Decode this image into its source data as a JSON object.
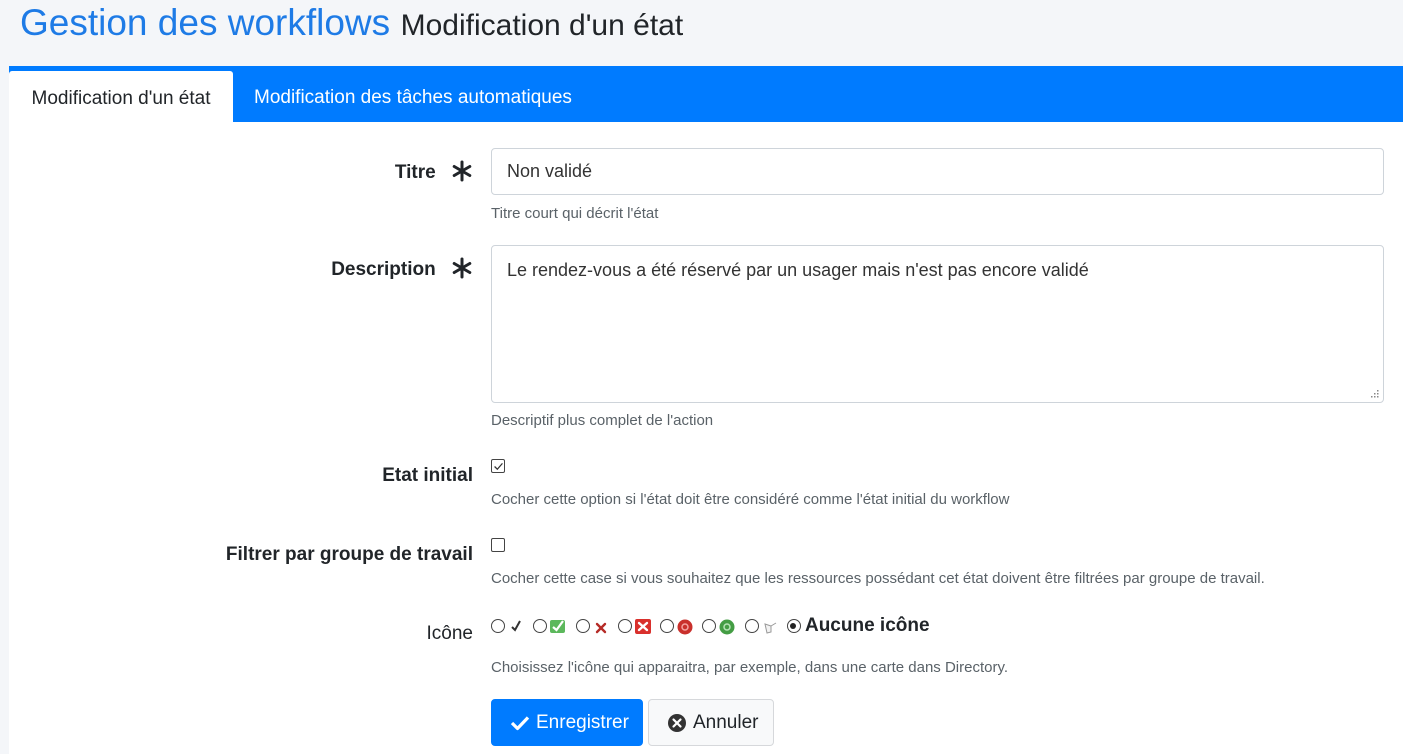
{
  "header": {
    "title": "Gestion des workflows",
    "subtitle": "Modification d'un état"
  },
  "tabs": [
    {
      "label": "Modification d'un état",
      "active": true
    },
    {
      "label": "Modification des tâches automatiques",
      "active": false
    }
  ],
  "form": {
    "title_field": {
      "label": "Titre",
      "value": "Non validé",
      "help": "Titre court qui décrit l'état"
    },
    "description_field": {
      "label": "Description",
      "value": "Le rendez-vous a été réservé par un usager mais n'est pas encore validé",
      "help": "Descriptif plus complet de l'action"
    },
    "initial_state": {
      "label": "Etat initial",
      "checked": true,
      "help": "Cocher cette option si l'état doit être considéré comme l'état initial du workflow"
    },
    "filter_workgroup": {
      "label": "Filtrer par groupe de travail",
      "checked": false,
      "help": "Cocher cette case si vous souhaitez que les ressources possédant cet état doivent être filtrées par groupe de travail."
    },
    "icon": {
      "label": "Icône",
      "options": [
        "check-small-icon",
        "check-green-icon",
        "cross-small-icon",
        "cross-red-icon",
        "red-circle-icon",
        "green-circle-icon",
        "hand-icon"
      ],
      "none_label": "Aucune icône",
      "selected": "none",
      "help": "Choisissez l'icône qui apparaitra, par exemple, dans une carte dans Directory."
    }
  },
  "buttons": {
    "save": "Enregistrer",
    "cancel": "Annuler"
  },
  "colors": {
    "primary": "#007bff",
    "title_blue": "#1e7be6"
  }
}
